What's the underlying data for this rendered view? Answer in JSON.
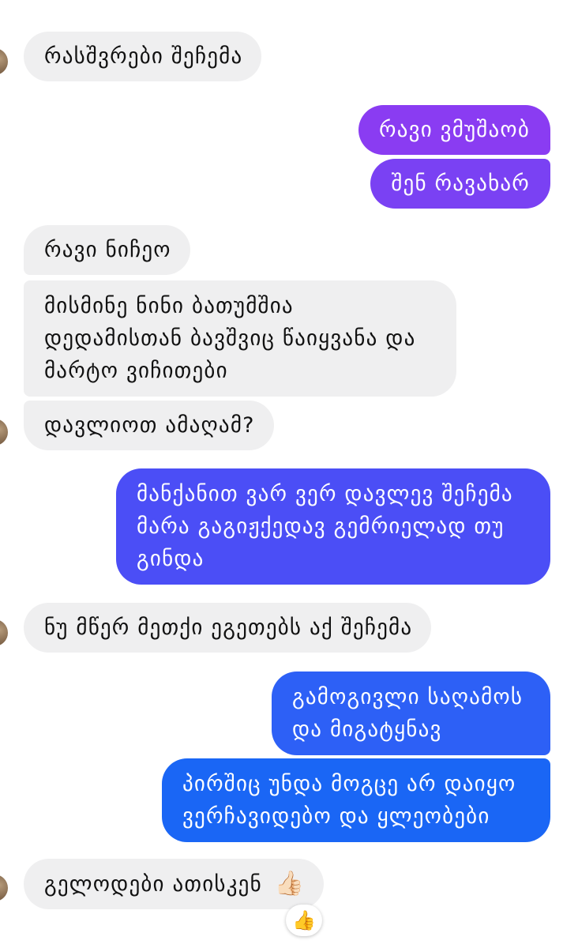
{
  "messages": [
    {
      "dir": "in",
      "lines": [
        "რასშვრები შეჩემა"
      ]
    },
    {
      "dir": "out",
      "lines": [
        "რავი ვმუშაობ"
      ]
    },
    {
      "dir": "out",
      "lines": [
        "შენ რავახარ"
      ]
    },
    {
      "dir": "in",
      "lines": [
        "რავი ნიჩეო"
      ]
    },
    {
      "dir": "in",
      "lines": [
        "მისმინე ნინი ბათუმშია",
        "დედამისთან ბავშვიც წაიყვანა და",
        "მარტო ვიჩითები"
      ]
    },
    {
      "dir": "in",
      "lines": [
        "დავლიოთ ამაღამ?"
      ]
    },
    {
      "dir": "out",
      "lines": [
        "მანქანით ვარ ვერ დავლევ შეჩემა",
        "მარა გაგიჟქედავ გემრიელად თუ",
        "გინდა"
      ]
    },
    {
      "dir": "in",
      "lines": [
        "ნუ მწერ მეთქი ეგეთებს აქ შეჩემა"
      ]
    },
    {
      "dir": "out",
      "lines": [
        "გამოგივლი საღამოს",
        "და მიგატყნავ"
      ]
    },
    {
      "dir": "out",
      "lines": [
        "პირშიც უნდა მოგცე არ დაიყო",
        "ვერჩავიდებო და ყლეობები"
      ]
    },
    {
      "dir": "in",
      "lines": [
        "გელოდები ათისკენ"
      ],
      "emoji": "👍🏻"
    }
  ],
  "reaction": {
    "emoji": "👍"
  },
  "colors": {
    "incoming_bg": "#efeff0",
    "out_purple": "#8a3cf2",
    "out_indigo": "#4b4ef6",
    "out_blue": "#1a66f5"
  }
}
